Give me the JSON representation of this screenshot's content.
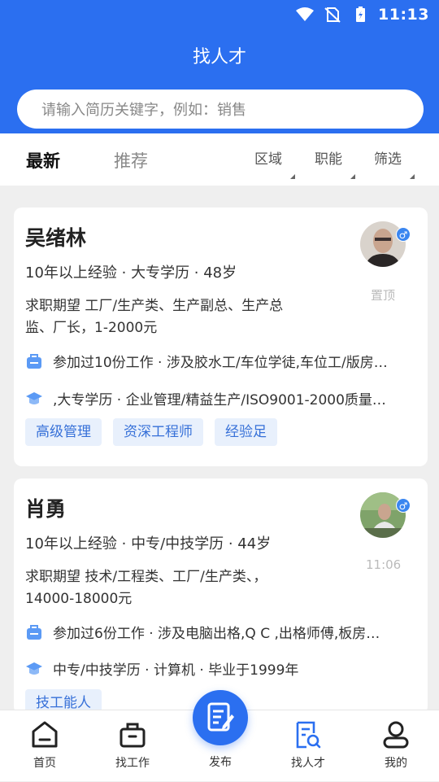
{
  "status": {
    "time": "11:13"
  },
  "header": {
    "title": "找人才"
  },
  "search": {
    "placeholder": "请输入简历关键字，例如：销售"
  },
  "tabs": [
    {
      "label": "最新"
    },
    {
      "label": "推荐"
    }
  ],
  "filters": [
    {
      "label": "区域"
    },
    {
      "label": "职能"
    },
    {
      "label": "筛选"
    }
  ],
  "candidates": [
    {
      "name": "吴绪林",
      "meta": "10年以上经验 · 大专学历 · 48岁",
      "expect_line1": "求职期望 工厂/生产类、生产副总、生产总",
      "expect_line2": "监、厂长，1-2000元",
      "work": "参加过10份工作 · 涉及胶水工/车位学徒,车位工/版房…",
      "edu": ",大专学历 · 企业管理/精益生产/ISO9001-2000质量…",
      "tags": [
        "高级管理",
        "资深工程师",
        "经验足"
      ],
      "side_note": "置顶",
      "gender": "♂"
    },
    {
      "name": "肖勇",
      "meta": "10年以上经验 · 中专/中技学历 · 44岁",
      "expect_line1": "求职期望 技术/工程类、工厂/生产类、，",
      "expect_line2": "14000-18000元",
      "work": "参加过6份工作 · 涉及电脑出格,Q C ,出格师傅,板房…",
      "edu": "中专/中技学历 · 计算机 · 毕业于1999年",
      "tags": [
        "技工能人"
      ],
      "side_note": "11:06",
      "gender": "♂"
    }
  ],
  "bottom_nav": [
    {
      "label": "首页",
      "icon": "home-icon"
    },
    {
      "label": "找工作",
      "icon": "briefcase-icon"
    },
    {
      "label": "发布",
      "icon": "edit-icon"
    },
    {
      "label": "找人才",
      "icon": "talent-search-icon"
    },
    {
      "label": "我的",
      "icon": "user-icon"
    }
  ],
  "colors": {
    "primary": "#2b6ff0",
    "tag_bg": "#e8f0fc",
    "tag_text": "#3670d8"
  }
}
